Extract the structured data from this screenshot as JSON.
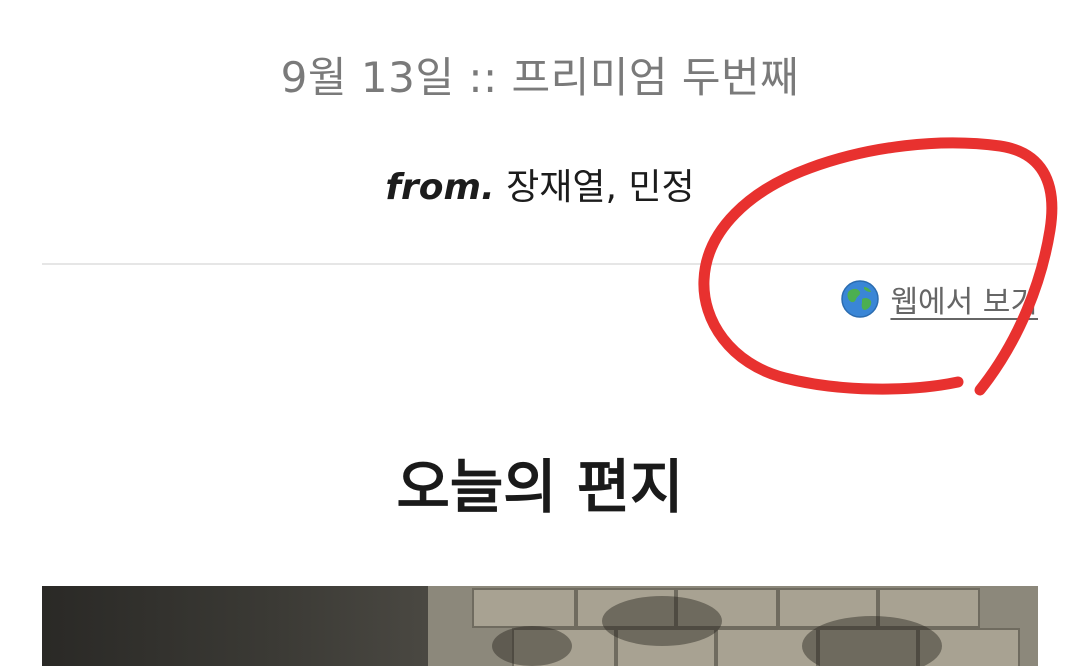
{
  "header": {
    "date_title": "9월 13일 :: 프리미엄 두번째"
  },
  "sender": {
    "prefix": "from.",
    "names": " 장재열, 민정"
  },
  "web_view": {
    "label": "웹에서 보기",
    "icon": "globe-icon"
  },
  "section": {
    "title": "오늘의 편지"
  },
  "annotation": {
    "color": "#e8312f"
  },
  "colors": {
    "muted_text": "#7a7a7a",
    "link_text": "#666666",
    "heading_text": "#1a1a1a"
  }
}
